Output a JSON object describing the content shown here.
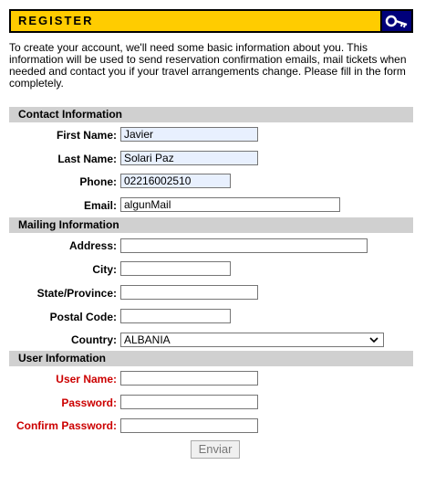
{
  "banner": {
    "title": "REGISTER",
    "icon": "key-icon"
  },
  "intro": "To create your account, we'll need some basic information about you. This information will be used to send reservation confirmation emails, mail tickets when needed and contact you if your travel arrangements change. Please fill in the form completely.",
  "sections": {
    "contact": "Contact Information",
    "mailing": "Mailing Information",
    "user": "User Information"
  },
  "contact": {
    "first_name": {
      "label": "First Name:",
      "value": "Javier"
    },
    "last_name": {
      "label": "Last Name:",
      "value": "Solari Paz"
    },
    "phone": {
      "label": "Phone:",
      "value": "02216002510"
    },
    "email": {
      "label": "Email:",
      "value": "algunMail"
    }
  },
  "mailing": {
    "address": {
      "label": "Address:",
      "value": ""
    },
    "city": {
      "label": "City:",
      "value": ""
    },
    "state": {
      "label": "State/Province:",
      "value": ""
    },
    "postal": {
      "label": "Postal Code:",
      "value": ""
    },
    "country": {
      "label": "Country:",
      "value": "ALBANIA"
    }
  },
  "user": {
    "username": {
      "label": "User Name:",
      "value": ""
    },
    "password": {
      "label": "Password:",
      "value": ""
    },
    "confirm": {
      "label": "Confirm Password:",
      "value": ""
    }
  },
  "submit_label": "Enviar",
  "colors": {
    "banner": "#ffcc00",
    "section": "#d0d0d0",
    "required": "#cc0000",
    "autofill": "#e8f0fe"
  }
}
